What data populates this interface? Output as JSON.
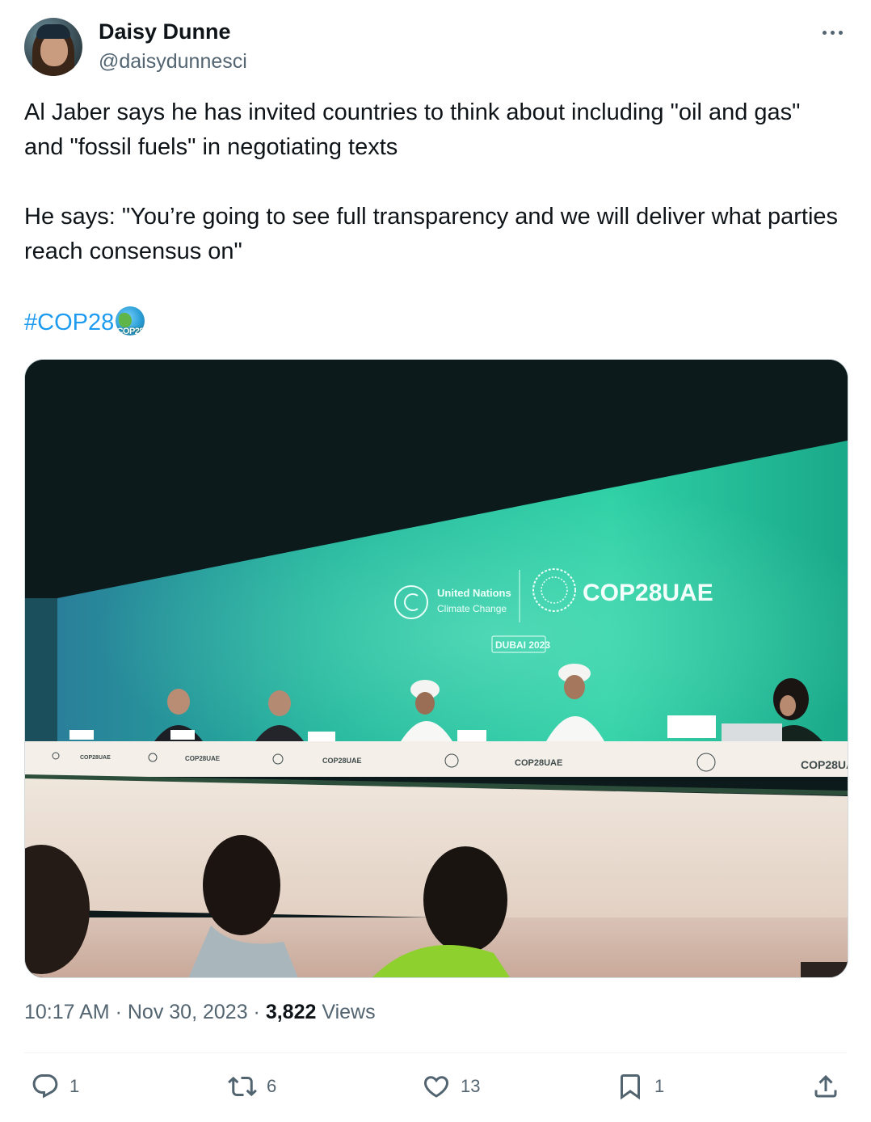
{
  "author": {
    "display_name": "Daisy Dunne",
    "handle": "@daisydunnesci"
  },
  "tweet": {
    "paragraphs": [
      "Al Jaber says he has invited countries to think about including \"oil and gas\" and \"fossil fuels\" in negotiating texts",
      "He says: \"You’re going to see full transparency and we will deliver what parties reach consensus on\""
    ],
    "hashtag": "#COP28",
    "hashtag_emoji_text": "COP28"
  },
  "media": {
    "unfccc_line1": "United Nations",
    "unfccc_line2": "Climate Change",
    "cop_logo": "COP28UAE",
    "location": "DUBAI 2023"
  },
  "meta": {
    "time": "10:17 AM",
    "separator": "·",
    "date": "Nov 30, 2023",
    "views_count": "3,822",
    "views_label": "Views"
  },
  "actions": {
    "replies": "1",
    "retweets": "6",
    "likes": "13",
    "bookmarks": "1"
  },
  "colors": {
    "link": "#1d9bf0",
    "secondary_text": "#536471",
    "primary_text": "#0f1419"
  },
  "icons": [
    "more-icon",
    "reply-icon",
    "retweet-icon",
    "like-icon",
    "bookmark-icon",
    "share-icon"
  ]
}
